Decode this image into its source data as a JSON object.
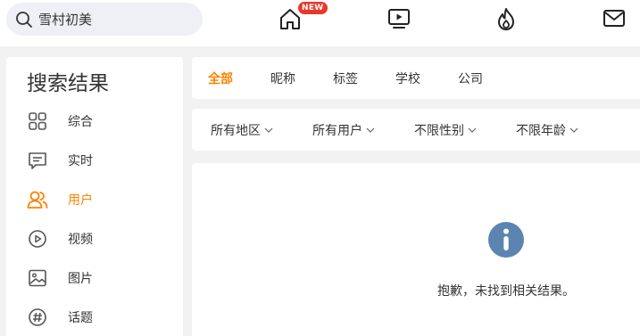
{
  "search": {
    "query": "雪村初美"
  },
  "nav": {
    "home_badge": "NEW",
    "icons": [
      "home-icon",
      "video-icon",
      "hot-icon",
      "mail-icon"
    ]
  },
  "sidebar": {
    "title": "搜索结果",
    "items": [
      {
        "label": "综合",
        "icon": "grid-icon"
      },
      {
        "label": "实时",
        "icon": "message-icon"
      },
      {
        "label": "用户",
        "icon": "users-icon",
        "active": true
      },
      {
        "label": "视频",
        "icon": "play-circle-icon"
      },
      {
        "label": "图片",
        "icon": "image-icon"
      },
      {
        "label": "话题",
        "icon": "hashtag-icon"
      }
    ]
  },
  "tabs": [
    {
      "label": "全部",
      "active": true
    },
    {
      "label": "昵称"
    },
    {
      "label": "标签"
    },
    {
      "label": "学校"
    },
    {
      "label": "公司"
    }
  ],
  "filters": [
    {
      "label": "所有地区"
    },
    {
      "label": "所有用户"
    },
    {
      "label": "不限性别"
    },
    {
      "label": "不限年龄"
    }
  ],
  "results": {
    "empty_message": "抱歉，未找到相关结果。"
  },
  "colors": {
    "accent": "#ff8200",
    "info_icon": "#5b84b1",
    "badge": "#e8382c",
    "background": "#f2f2f2"
  }
}
